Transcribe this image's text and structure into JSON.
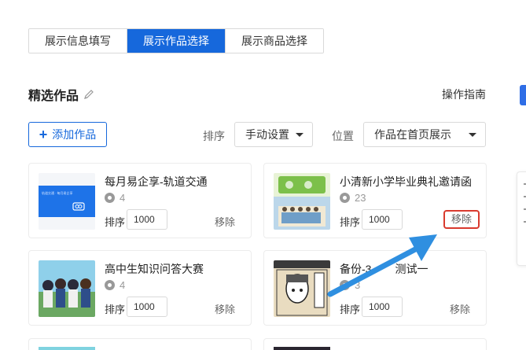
{
  "tabs": [
    {
      "label": "展示信息填写",
      "active": false
    },
    {
      "label": "展示作品选择",
      "active": true
    },
    {
      "label": "展示商品选择",
      "active": false
    }
  ],
  "section": {
    "title": "精选作品",
    "edit_icon": "pencil-icon",
    "guide": "操作指南"
  },
  "toolbar": {
    "add_label": "添加作品",
    "sort_label": "排序",
    "sort_value": "手动设置",
    "position_label": "位置",
    "position_value": "作品在首页展示"
  },
  "works": [
    {
      "title": "每月易企享-轨道交通",
      "views": "4",
      "sort_label": "排序",
      "sort": "1000",
      "remove": "移除",
      "highlighted": false,
      "thumb_text": "轨道交通 · 每月易企享"
    },
    {
      "title": "小清新小学毕业典礼邀请函",
      "views": "23",
      "sort_label": "排序",
      "sort": "1000",
      "remove": "移除",
      "highlighted": true
    },
    {
      "title": "高中生知识问答大赛",
      "views": "4",
      "sort_label": "排序",
      "sort": "1000",
      "remove": "移除",
      "highlighted": false
    },
    {
      "title": "备份-3",
      "title_tail": "测试一",
      "views": "3",
      "sort_label": "排序",
      "sort": "1000",
      "remove": "移除",
      "highlighted": false
    }
  ],
  "colors": {
    "primary": "#1668dc",
    "highlight": "#d93a2e",
    "arrow": "#2f8fe0"
  }
}
